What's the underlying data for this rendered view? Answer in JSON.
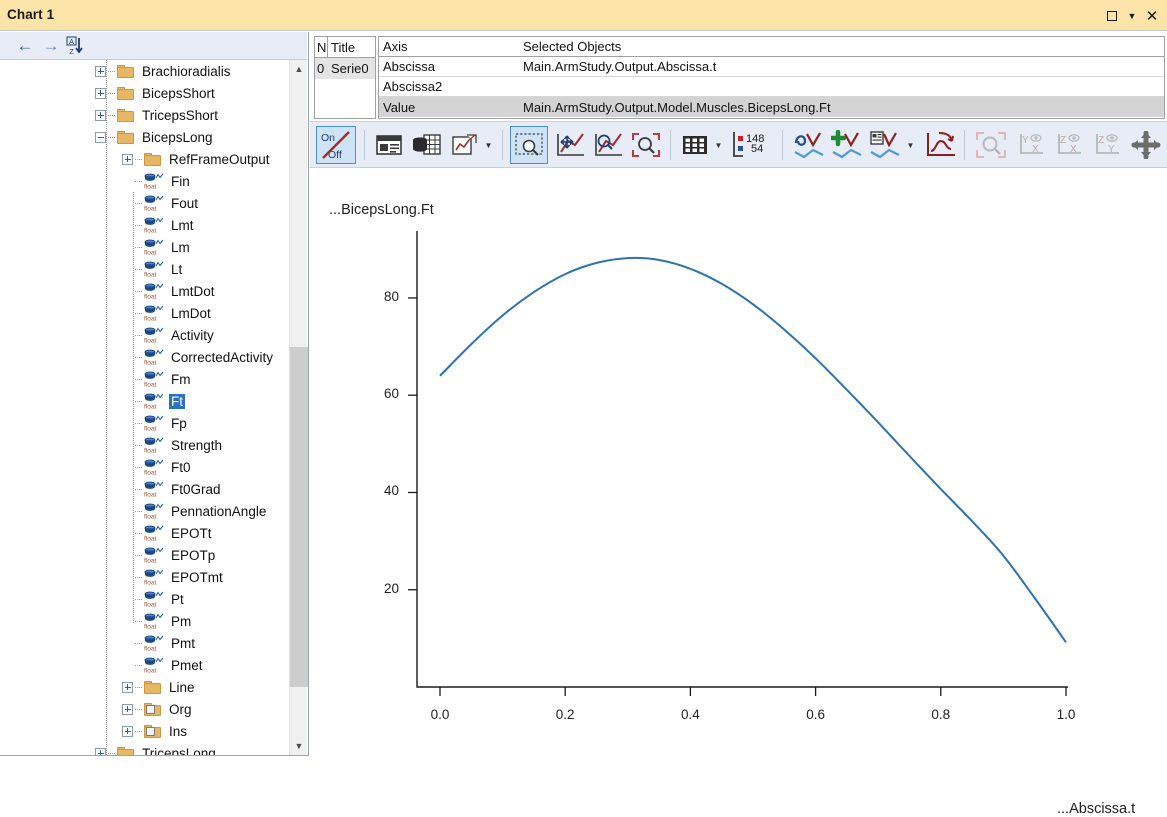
{
  "window": {
    "title": "Chart 1",
    "restore_icon": "restore-window-icon",
    "menu_icon": "chevron-down-icon",
    "close_label": "✕"
  },
  "tree_toolbar": {
    "back_label": "←",
    "forward_label": "→",
    "sort_icon": "sort-alphabetical-icon"
  },
  "tree": {
    "items": [
      {
        "label": "Brachioradialis",
        "depth": 1,
        "kind": "folder",
        "state": "collapsed",
        "selected": false
      },
      {
        "label": "BicepsShort",
        "depth": 1,
        "kind": "folder",
        "state": "collapsed",
        "selected": false
      },
      {
        "label": "TricepsShort",
        "depth": 1,
        "kind": "folder",
        "state": "collapsed",
        "selected": false
      },
      {
        "label": "BicepsLong",
        "depth": 1,
        "kind": "folder",
        "state": "expanded",
        "selected": false
      },
      {
        "label": "RefFrameOutput",
        "depth": 2,
        "kind": "folder",
        "state": "collapsed",
        "selected": false
      },
      {
        "label": "Fin",
        "depth": 2,
        "kind": "float",
        "state": "leaf",
        "selected": false
      },
      {
        "label": "Fout",
        "depth": 2,
        "kind": "float",
        "state": "leaf",
        "selected": false
      },
      {
        "label": "Lmt",
        "depth": 2,
        "kind": "float",
        "state": "leaf",
        "selected": false
      },
      {
        "label": "Lm",
        "depth": 2,
        "kind": "float",
        "state": "leaf",
        "selected": false
      },
      {
        "label": "Lt",
        "depth": 2,
        "kind": "float",
        "state": "leaf",
        "selected": false
      },
      {
        "label": "LmtDot",
        "depth": 2,
        "kind": "float",
        "state": "leaf",
        "selected": false
      },
      {
        "label": "LmDot",
        "depth": 2,
        "kind": "float",
        "state": "leaf",
        "selected": false
      },
      {
        "label": "Activity",
        "depth": 2,
        "kind": "float",
        "state": "leaf",
        "selected": false
      },
      {
        "label": "CorrectedActivity",
        "depth": 2,
        "kind": "float",
        "state": "leaf",
        "selected": false
      },
      {
        "label": "Fm",
        "depth": 2,
        "kind": "float",
        "state": "leaf",
        "selected": false
      },
      {
        "label": "Ft",
        "depth": 2,
        "kind": "float",
        "state": "leaf",
        "selected": true
      },
      {
        "label": "Fp",
        "depth": 2,
        "kind": "float",
        "state": "leaf",
        "selected": false
      },
      {
        "label": "Strength",
        "depth": 2,
        "kind": "float",
        "state": "leaf",
        "selected": false
      },
      {
        "label": "Ft0",
        "depth": 2,
        "kind": "float",
        "state": "leaf",
        "selected": false
      },
      {
        "label": "Ft0Grad",
        "depth": 2,
        "kind": "float",
        "state": "leaf",
        "selected": false
      },
      {
        "label": "PennationAngle",
        "depth": 2,
        "kind": "float",
        "state": "leaf",
        "selected": false
      },
      {
        "label": "EPOTt",
        "depth": 2,
        "kind": "float",
        "state": "leaf",
        "selected": false
      },
      {
        "label": "EPOTp",
        "depth": 2,
        "kind": "float",
        "state": "leaf",
        "selected": false
      },
      {
        "label": "EPOTmt",
        "depth": 2,
        "kind": "float",
        "state": "leaf",
        "selected": false
      },
      {
        "label": "Pt",
        "depth": 2,
        "kind": "float",
        "state": "leaf",
        "selected": false
      },
      {
        "label": "Pm",
        "depth": 2,
        "kind": "float",
        "state": "leaf",
        "selected": false
      },
      {
        "label": "Pmt",
        "depth": 2,
        "kind": "float",
        "state": "leaf",
        "selected": false
      },
      {
        "label": "Pmet",
        "depth": 2,
        "kind": "float",
        "state": "leaf",
        "selected": false
      },
      {
        "label": "Line",
        "depth": 2,
        "kind": "folder",
        "state": "collapsed",
        "selected": false
      },
      {
        "label": "Org",
        "depth": 2,
        "kind": "folder-link",
        "state": "collapsed",
        "selected": false
      },
      {
        "label": "Ins",
        "depth": 2,
        "kind": "folder-link",
        "state": "collapsed",
        "selected": false
      },
      {
        "label": "TricepsLong",
        "depth": 1,
        "kind": "folder",
        "state": "collapsed",
        "selected": false
      }
    ],
    "float_type_label": "float"
  },
  "series_grid": {
    "columns": [
      "N",
      "Title"
    ],
    "rows": [
      {
        "n": "0",
        "title": "Serie0"
      }
    ]
  },
  "objects_grid": {
    "columns": [
      "Axis",
      "Selected Objects"
    ],
    "rows": [
      {
        "axis": "Abscissa",
        "object": "Main.ArmStudy.Output.Abscissa.t",
        "shaded": false
      },
      {
        "axis": "Abscissa2",
        "object": "",
        "shaded": false
      },
      {
        "axis": "Value",
        "object": "Main.ArmStudy.Output.Model.Muscles.BicepsLong.Ft",
        "shaded": true
      }
    ]
  },
  "toolbar": {
    "onoff": {
      "name": "on-off-toggle-button",
      "on_label": "On",
      "off_label": "Off",
      "selected": true
    },
    "buttons": [
      {
        "name": "chart-properties-button",
        "icon": "properties-panel-icon"
      },
      {
        "name": "data-table-button",
        "icon": "database-table-icon"
      },
      {
        "name": "new-chart-button",
        "icon": "new-chart-icon",
        "has_caret": true
      },
      {
        "name": "rectangle-zoom-button",
        "icon": "marquee-zoom-icon",
        "selected": true
      },
      {
        "name": "pan-chart-button",
        "icon": "pan-curve-icon"
      },
      {
        "name": "zoom-curve-button",
        "icon": "zoom-curve-icon"
      },
      {
        "name": "zoom-fit-button",
        "icon": "zoom-fit-icon"
      },
      {
        "name": "grid-toggle-button",
        "icon": "grid-icon",
        "has_caret": true
      },
      {
        "name": "point-count-button",
        "icon": "point-count-icon"
      },
      {
        "name": "smooth-curve-button",
        "icon": "smooth-curve-icon"
      },
      {
        "name": "add-curve-button",
        "icon": "add-curve-icon"
      },
      {
        "name": "curve-settings-button",
        "icon": "curve-settings-icon",
        "has_caret": true
      },
      {
        "name": "redo-curve-button",
        "icon": "reset-curve-icon"
      },
      {
        "name": "zoom-region-button",
        "icon": "zoom-region-icon",
        "disabled": true
      },
      {
        "name": "view-yx-button",
        "icon": "view-yx-icon",
        "disabled": true
      },
      {
        "name": "view-zx-button",
        "icon": "view-zx-icon",
        "disabled": true
      },
      {
        "name": "view-zy-button",
        "icon": "view-zy-icon",
        "disabled": true
      },
      {
        "name": "move-view-button",
        "icon": "move-arrows-icon"
      },
      {
        "name": "zoom-in-out-button",
        "icon": "zoom-in-out-icon"
      }
    ],
    "point_count": {
      "top": "148",
      "bottom": "54",
      "top_color": "#cc2020",
      "bottom_color": "#2a4fa5"
    }
  },
  "chart_data": {
    "type": "line",
    "title": "...BicepsLong.Ft",
    "xlabel": "...Abscissa.t",
    "ylabel": "",
    "xlim": [
      0.0,
      1.0
    ],
    "ylim": [
      0.0,
      95.0
    ],
    "xticks": [
      "0.0",
      "0.2",
      "0.4",
      "0.6",
      "0.8",
      "1.0"
    ],
    "yticks": [
      "20",
      "40",
      "60",
      "80"
    ],
    "grid": false,
    "legend": "none",
    "line_color": "#2d72b0",
    "series": [
      {
        "name": "Serie0",
        "x": [
          0.0,
          0.05,
          0.1,
          0.15,
          0.2,
          0.25,
          0.3,
          0.35,
          0.4,
          0.45,
          0.5,
          0.55,
          0.6,
          0.65,
          0.7,
          0.75,
          0.8,
          0.85,
          0.9,
          0.95,
          1.0
        ],
        "values": [
          64.0,
          70.5,
          76.4,
          81.2,
          84.9,
          87.2,
          88.2,
          87.8,
          86.0,
          82.9,
          78.7,
          73.5,
          67.6,
          61.1,
          54.4,
          47.5,
          40.7,
          34.1,
          27.0,
          18.3,
          9.2
        ]
      }
    ]
  }
}
